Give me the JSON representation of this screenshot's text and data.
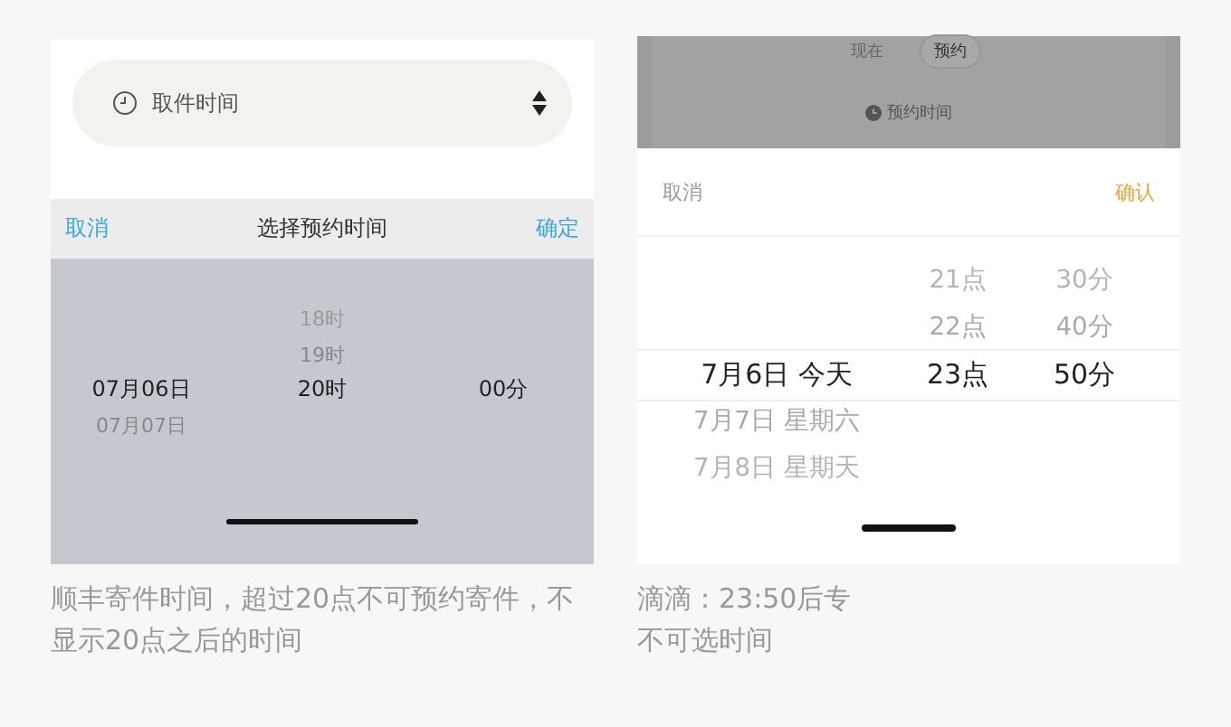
{
  "sf_panel": {
    "field": {
      "label": "取件时间"
    },
    "picker": {
      "cancel": "取消",
      "title": "选择预约时间",
      "confirm": "确定",
      "columns": [
        {
          "items": [
            {
              "text": "07月06日",
              "selected": true
            },
            {
              "text": "07月07日",
              "selected": false
            }
          ]
        },
        {
          "items": [
            {
              "text": "18时",
              "selected": false
            },
            {
              "text": "19时",
              "selected": false
            },
            {
              "text": "20时",
              "selected": true
            }
          ]
        },
        {
          "items": [
            {
              "text": "00分",
              "selected": true
            }
          ]
        }
      ]
    },
    "caption": "顺丰寄件时间，超过20点不可预约寄件，不显示20点之后的时间"
  },
  "didi_panel": {
    "tabs": [
      {
        "label": "现在",
        "selected": false
      },
      {
        "label": "预约",
        "selected": true
      }
    ],
    "time_label": "预约时间",
    "picker": {
      "cancel": "取消",
      "confirm": "确认",
      "columns": [
        {
          "items": [
            {
              "text": "7月6日 今天",
              "selected": true
            },
            {
              "text": "7月7日 星期六",
              "selected": false
            },
            {
              "text": "7月8日 星期天",
              "selected": false
            }
          ]
        },
        {
          "items": [
            {
              "text": "21点",
              "selected": false
            },
            {
              "text": "22点",
              "selected": false
            },
            {
              "text": "23点",
              "selected": true
            }
          ]
        },
        {
          "items": [
            {
              "text": "30分",
              "selected": false
            },
            {
              "text": "40分",
              "selected": false
            },
            {
              "text": "50分",
              "selected": true
            }
          ]
        }
      ]
    },
    "caption_lines": [
      "滴滴：23:50后专",
      "不可选时间"
    ]
  }
}
